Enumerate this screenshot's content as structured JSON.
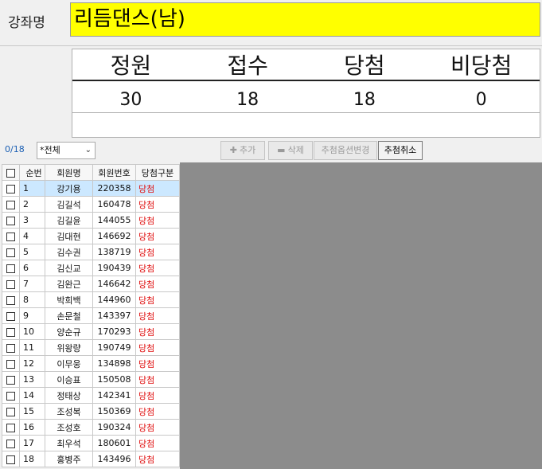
{
  "course": {
    "label": "강좌명",
    "name": "리듬댄스(남)"
  },
  "stats": {
    "headers": [
      "정원",
      "접수",
      "당첨",
      "비당첨"
    ],
    "values": [
      "30",
      "18",
      "18",
      "0"
    ]
  },
  "toolbar": {
    "count": "0/18",
    "filter": "*전체",
    "add_label": "추가",
    "delete_label": "삭제",
    "option_label": "추첨옵션변경",
    "cancel_label": "추첨취소"
  },
  "grid": {
    "columns": [
      "순번",
      "회원명",
      "회원번호",
      "당첨구분"
    ],
    "rows": [
      {
        "no": "1",
        "name": "강기용",
        "id": "220358",
        "status": "당첨"
      },
      {
        "no": "2",
        "name": "김길석",
        "id": "160478",
        "status": "당첨"
      },
      {
        "no": "3",
        "name": "김길윤",
        "id": "144055",
        "status": "당첨"
      },
      {
        "no": "4",
        "name": "김대현",
        "id": "146692",
        "status": "당첨"
      },
      {
        "no": "5",
        "name": "김수권",
        "id": "138719",
        "status": "당첨"
      },
      {
        "no": "6",
        "name": "김신교",
        "id": "190439",
        "status": "당첨"
      },
      {
        "no": "7",
        "name": "김완근",
        "id": "146642",
        "status": "당첨"
      },
      {
        "no": "8",
        "name": "박희백",
        "id": "144960",
        "status": "당첨"
      },
      {
        "no": "9",
        "name": "손문철",
        "id": "143397",
        "status": "당첨"
      },
      {
        "no": "10",
        "name": "양순규",
        "id": "170293",
        "status": "당첨"
      },
      {
        "no": "11",
        "name": "위왕량",
        "id": "190749",
        "status": "당첨"
      },
      {
        "no": "12",
        "name": "이무웅",
        "id": "134898",
        "status": "당첨"
      },
      {
        "no": "13",
        "name": "이승표",
        "id": "150508",
        "status": "당첨"
      },
      {
        "no": "14",
        "name": "정태상",
        "id": "142341",
        "status": "당첨"
      },
      {
        "no": "15",
        "name": "조성복",
        "id": "150369",
        "status": "당첨"
      },
      {
        "no": "16",
        "name": "조성호",
        "id": "190324",
        "status": "당첨"
      },
      {
        "no": "17",
        "name": "최우석",
        "id": "180601",
        "status": "당첨"
      },
      {
        "no": "18",
        "name": "홍병주",
        "id": "143496",
        "status": "당첨"
      }
    ]
  }
}
